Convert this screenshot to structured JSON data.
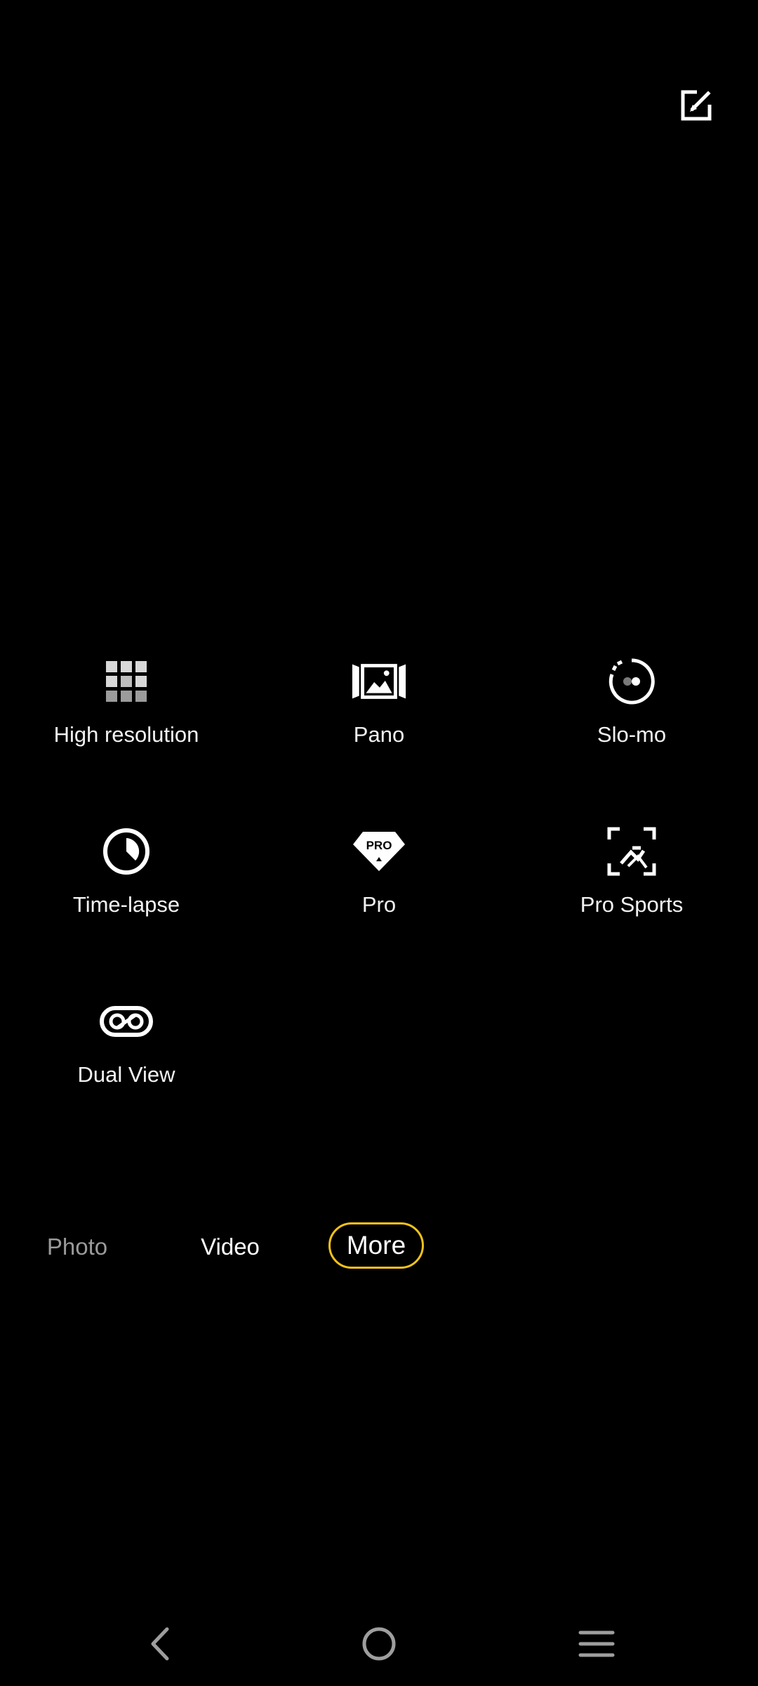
{
  "header": {
    "edit_icon": "edit-icon"
  },
  "modes": [
    {
      "label": "High resolution",
      "icon": "grid-icon"
    },
    {
      "label": "Pano",
      "icon": "panorama-icon"
    },
    {
      "label": "Slo-mo",
      "icon": "slow-motion-icon"
    },
    {
      "label": "Time-lapse",
      "icon": "timer-icon"
    },
    {
      "label": "Pro",
      "icon": "pro-badge-icon"
    },
    {
      "label": "Pro Sports",
      "icon": "sports-focus-icon"
    },
    {
      "label": "Dual View",
      "icon": "dual-view-icon"
    }
  ],
  "tabs": {
    "photo": "Photo",
    "video": "Video",
    "more": "More",
    "selected": "More"
  },
  "colors": {
    "background": "#000000",
    "accent": "#f2c21b",
    "inactive_tab": "#9a9a9a",
    "text": "#ffffff"
  },
  "nav": {
    "back_icon": "back-chevron-icon",
    "home_icon": "home-circle-icon",
    "menu_icon": "menu-lines-icon"
  }
}
